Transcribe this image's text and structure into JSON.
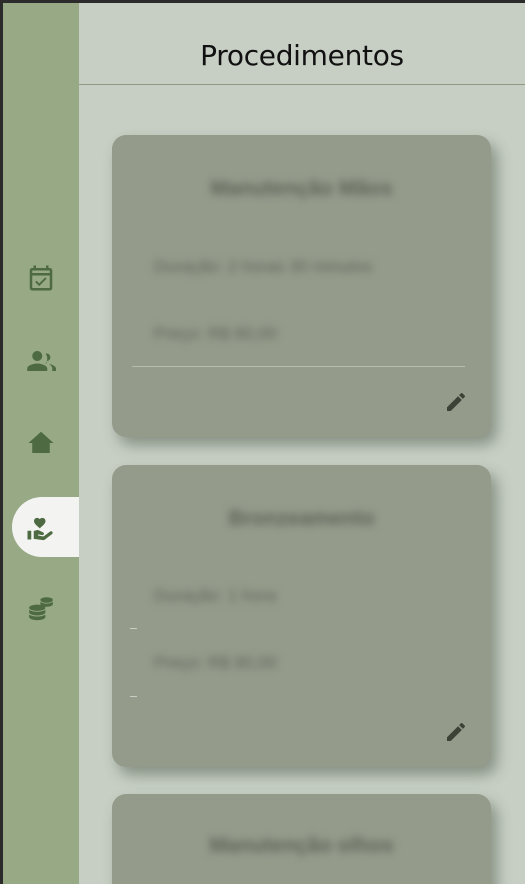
{
  "header": {
    "title": "Procedimentos"
  },
  "sidebar": {
    "items": [
      {
        "icon": "calendar-check-icon",
        "active": false
      },
      {
        "icon": "users-icon",
        "active": false
      },
      {
        "icon": "home-icon",
        "active": false
      },
      {
        "icon": "hand-heart-icon",
        "active": true
      },
      {
        "icon": "coins-icon",
        "active": false
      }
    ]
  },
  "cards": [
    {
      "title": "Manutenção Mãos",
      "line1": "Duração: 2 horas 30 minutos",
      "line2": "Preço: R$ 80,00"
    },
    {
      "title": "Bronzeamento",
      "line1": "Duração: 1 hora",
      "line2": "Preço: R$ 90,00"
    },
    {
      "title": "Manutenção olhos"
    }
  ],
  "colors": {
    "sidebar": "#97a985",
    "background": "#c7cfc4",
    "card": "#949b8b",
    "icon": "#4d6a42"
  }
}
